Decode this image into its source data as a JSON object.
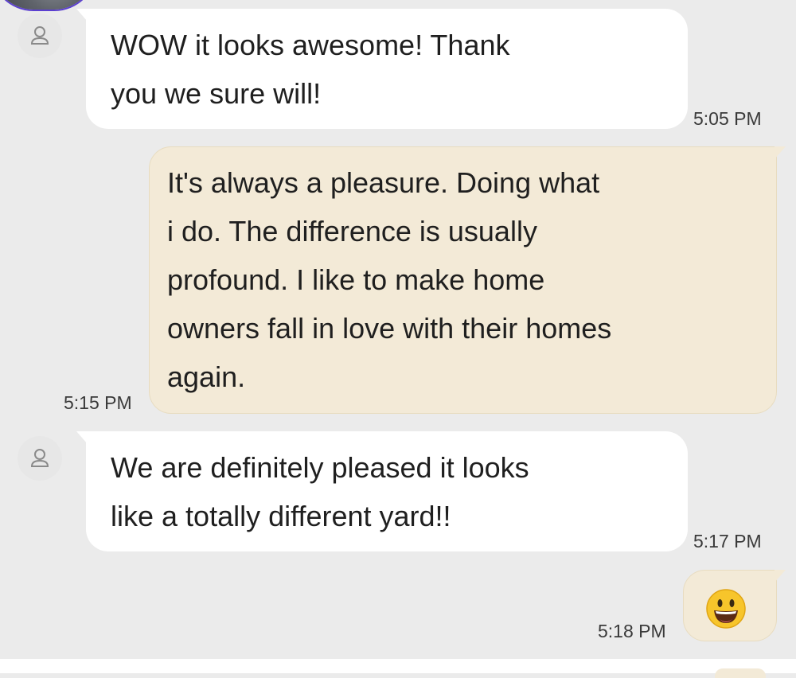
{
  "messages": [
    {
      "direction": "incoming",
      "text": "WOW it looks awesome! Thank\nyou we sure will!",
      "time": "5:05 PM",
      "avatar_icon": "person-icon"
    },
    {
      "direction": "outgoing",
      "text": "It's always a pleasure. Doing what\ni do. The difference is usually\nprofound. I like to make home\nowners fall in love with their homes\nagain.",
      "time": "5:15 PM"
    },
    {
      "direction": "incoming",
      "text": "We are definitely pleased it looks\nlike a totally different yard!!",
      "time": "5:17 PM",
      "avatar_icon": "person-icon"
    },
    {
      "direction": "outgoing",
      "emoji": "smiling-face-icon",
      "time": "5:18 PM"
    }
  ],
  "colors": {
    "background": "#ebebeb",
    "incoming_bubble": "#ffffff",
    "outgoing_bubble": "#f3ead7",
    "emoji_yellow": "#f7c52b"
  }
}
